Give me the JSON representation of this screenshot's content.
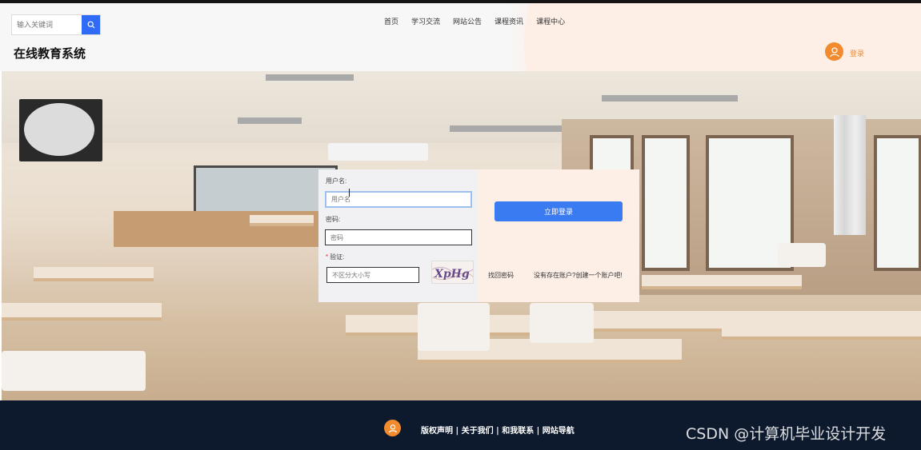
{
  "header": {
    "search": {
      "placeholder": "输入关键词",
      "button_icon": "search-icon"
    },
    "nav": [
      {
        "label": "首页"
      },
      {
        "label": "学习交流"
      },
      {
        "label": "网站公告"
      },
      {
        "label": "课程资讯"
      },
      {
        "label": "课程中心"
      }
    ],
    "site_title": "在线教育系统",
    "user_icon": "user-icon",
    "login_label": "登录"
  },
  "login_form": {
    "username": {
      "label": "用户名:",
      "placeholder": "用户名"
    },
    "password": {
      "label": "密码:",
      "placeholder": "密码"
    },
    "captcha": {
      "required_mark": "*",
      "label": "验证:",
      "placeholder": "不区分大小写",
      "image_text": "XpHg"
    },
    "submit_label": "立即登录",
    "forgot_label": "找回密码",
    "register_label": "没有存在账户?创建一个账户吧!"
  },
  "footer": {
    "icon": "user-icon",
    "links_text": "版权声明 | 关于我们 | 和我联系 | 网站导航"
  },
  "watermark": "CSDN @计算机毕业设计开发",
  "colors": {
    "accent_blue": "#3b7bf2",
    "accent_orange": "#f28a2e",
    "footer_bg": "#0d1a2e",
    "panel_peach": "#fdeee6"
  }
}
